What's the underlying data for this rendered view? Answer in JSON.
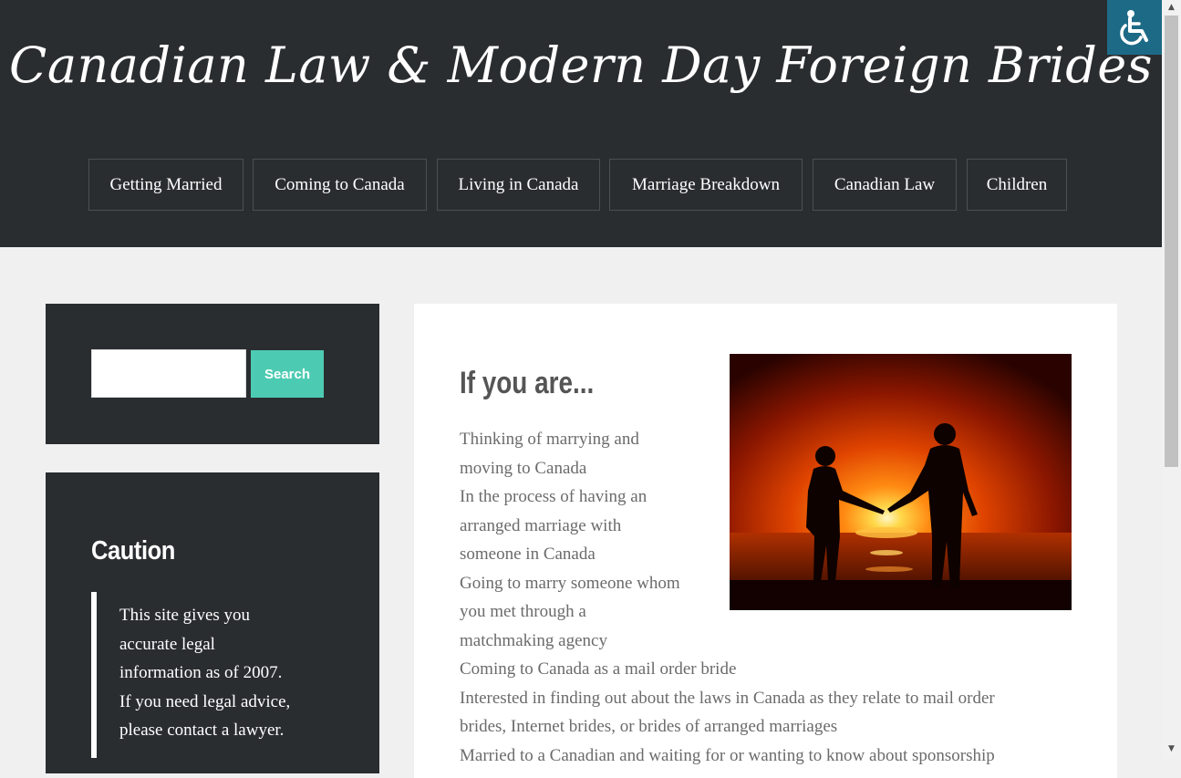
{
  "site": {
    "title": "Canadian Law & Modern Day Foreign Brides"
  },
  "nav": {
    "items": [
      {
        "label": "Getting Married"
      },
      {
        "label": "Coming to Canada"
      },
      {
        "label": "Living in Canada"
      },
      {
        "label": "Marriage Breakdown"
      },
      {
        "label": "Canadian Law"
      },
      {
        "label": "Children"
      }
    ]
  },
  "accessibility": {
    "icon": "wheelchair-icon"
  },
  "sidebar": {
    "search": {
      "input_value": "",
      "button_label": "Search"
    },
    "caution": {
      "title": "Caution",
      "lines": [
        "This site gives you",
        "accurate legal",
        "information as of 2007.",
        "If you need legal advice,",
        "please contact a lawyer."
      ]
    }
  },
  "post": {
    "title": "If you are...",
    "image": "couple-sunset-silhouette",
    "lines": [
      "Thinking of marrying and",
      "moving to Canada",
      "In the process of having an",
      "arranged marriage with",
      "someone in Canada",
      "Going to marry someone whom",
      "you met through a",
      "matchmaking agency",
      "Coming to Canada as a mail order bride",
      "Interested in finding out about the laws in Canada as they relate to mail order",
      "brides, Internet brides, or brides of arranged marriages",
      "Married to a Canadian and waiting for or wanting to know about sponsorship"
    ]
  },
  "colors": {
    "header_bg": "#2a2d30",
    "page_bg": "#f0f0f0",
    "accent": "#4dcbb2",
    "accessibility_bg": "#1d6a86"
  }
}
